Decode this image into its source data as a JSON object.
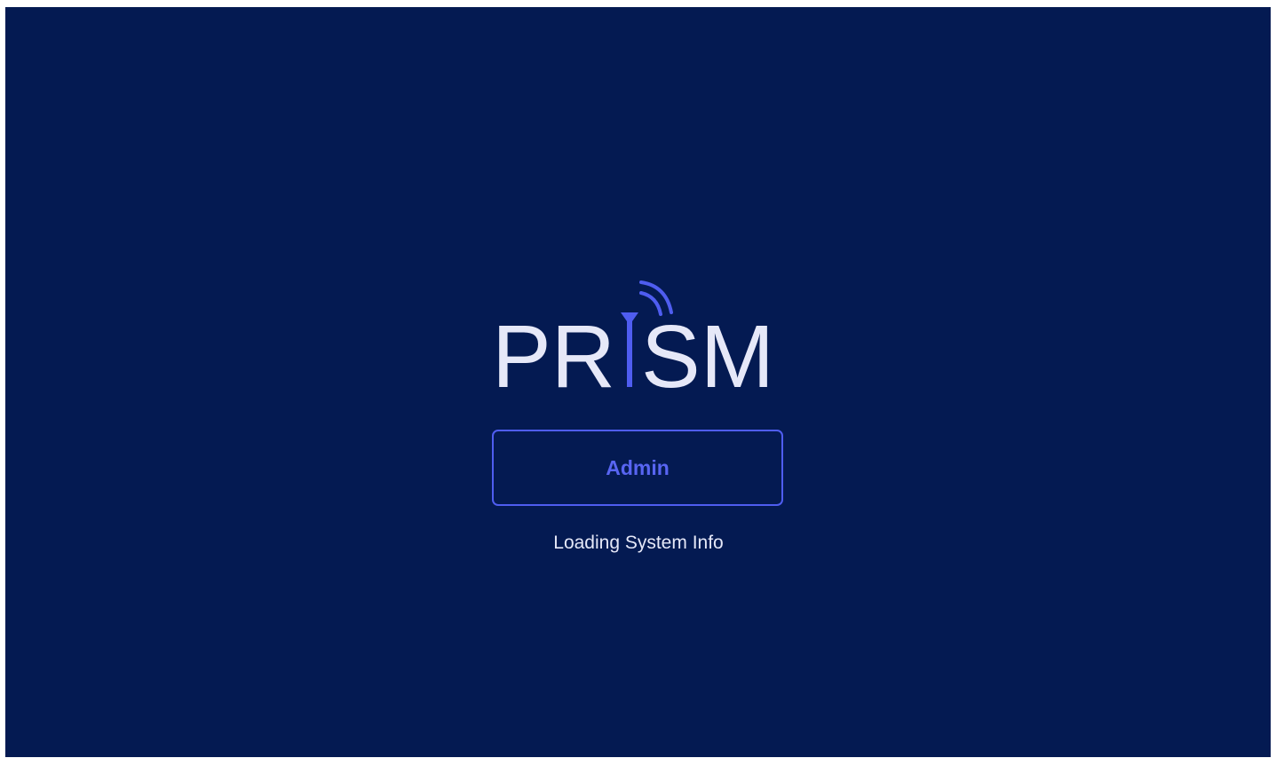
{
  "app": {
    "logo_text": "PRISM"
  },
  "login": {
    "admin_label": "Admin"
  },
  "status": {
    "message": "Loading System Info"
  },
  "colors": {
    "background": "#041a52",
    "accent": "#4f5df0",
    "logo_text": "#e6e8f8"
  }
}
